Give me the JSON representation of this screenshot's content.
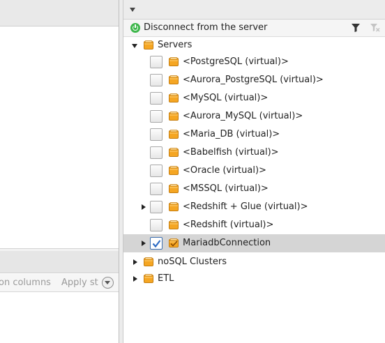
{
  "left_pane": {
    "toolbar": {
      "columns_text": "on columns",
      "apply_text": "Apply st"
    }
  },
  "right_pane": {
    "action_bar": {
      "disconnect_label": "Disconnect from the server"
    },
    "tree": {
      "servers": {
        "label": "Servers",
        "expanded": true,
        "items": [
          {
            "label": "<PostgreSQL (virtual)>",
            "checked": false,
            "expandable": false
          },
          {
            "label": "<Aurora_PostgreSQL (virtual)>",
            "checked": false,
            "expandable": false
          },
          {
            "label": "<MySQL (virtual)>",
            "checked": false,
            "expandable": false
          },
          {
            "label": "<Aurora_MySQL (virtual)>",
            "checked": false,
            "expandable": false
          },
          {
            "label": "<Maria_DB (virtual)>",
            "checked": false,
            "expandable": false
          },
          {
            "label": "<Babelfish (virtual)>",
            "checked": false,
            "expandable": false
          },
          {
            "label": "<Oracle (virtual)>",
            "checked": false,
            "expandable": false
          },
          {
            "label": "<MSSQL (virtual)>",
            "checked": false,
            "expandable": false
          },
          {
            "label": "<Redshift + Glue (virtual)>",
            "checked": false,
            "expandable": true
          },
          {
            "label": "<Redshift (virtual)>",
            "checked": false,
            "expandable": false
          },
          {
            "label": "MariadbConnection",
            "checked": true,
            "expandable": true,
            "selected": true
          }
        ]
      },
      "nosql": {
        "label": "noSQL Clusters",
        "expanded": false
      },
      "etl": {
        "label": "ETL",
        "expanded": false
      }
    }
  },
  "colors": {
    "db_orange": "#f5a623",
    "selection_bg": "#d5d5d5",
    "power_green": "#3cb64a",
    "check_blue": "#2d6bc4"
  }
}
